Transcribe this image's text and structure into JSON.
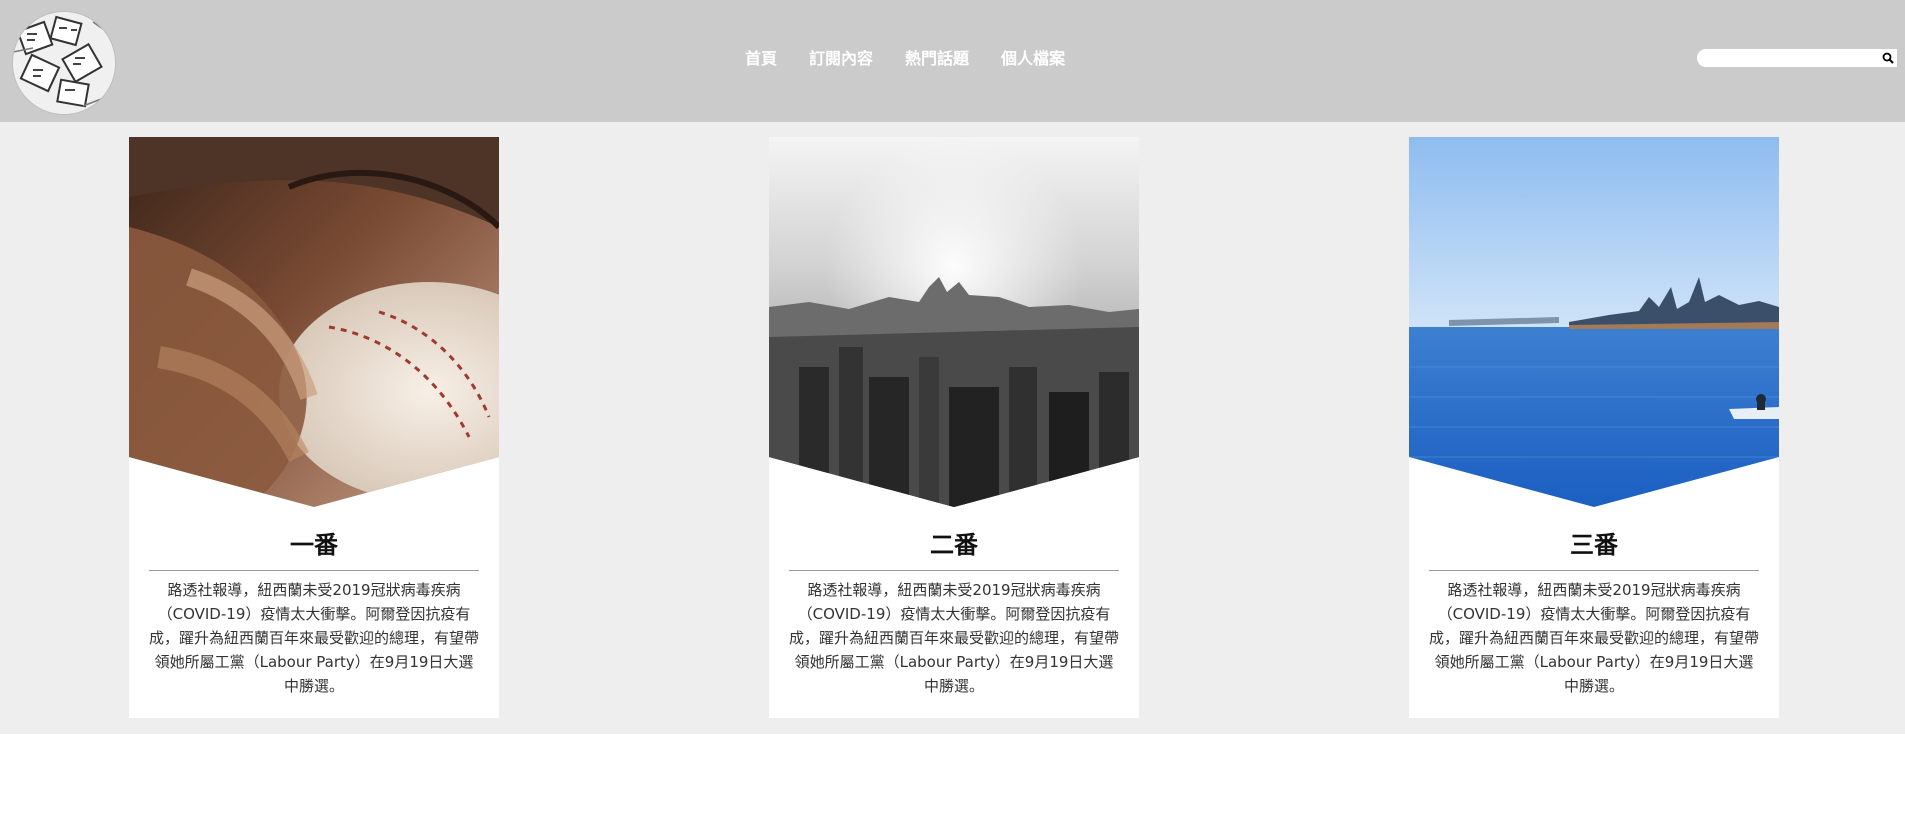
{
  "header": {
    "logo_icon": "comic-collage-logo-icon",
    "nav": [
      "首頁",
      "訂閱內容",
      "熱門話題",
      "個人檔案"
    ],
    "search": {
      "value": "",
      "placeholder": "",
      "icon": "search-icon"
    }
  },
  "cards": [
    {
      "image": "baseball-glove-photo",
      "title": "一番",
      "body": "路透社報導，紐西蘭未受2019冠狀病毒疾病（COVID-19）疫情太大衝擊。阿爾登因抗疫有成，躍升為紐西蘭百年來最受歡迎的總理，有望帶領她所屬工黨（Labour Party）在9月19日大選中勝選。"
    },
    {
      "image": "city-skyline-bw-photo",
      "title": "二番",
      "body": "路透社報導，紐西蘭未受2019冠狀病毒疾病（COVID-19）疫情太大衝擊。阿爾登因抗疫有成，躍升為紐西蘭百年來最受歡迎的總理，有望帶領她所屬工黨（Labour Party）在9月19日大選中勝選。"
    },
    {
      "image": "bay-skyline-photo",
      "title": "三番",
      "body": "路透社報導，紐西蘭未受2019冠狀病毒疾病（COVID-19）疫情太大衝擊。阿爾登因抗疫有成，躍升為紐西蘭百年來最受歡迎的總理，有望帶領她所屬工黨（Labour Party）在9月19日大選中勝選。"
    }
  ],
  "colors": {
    "header_bg": "#cbcbcb",
    "main_bg": "#eeeeee",
    "card_bg": "#ffffff"
  }
}
